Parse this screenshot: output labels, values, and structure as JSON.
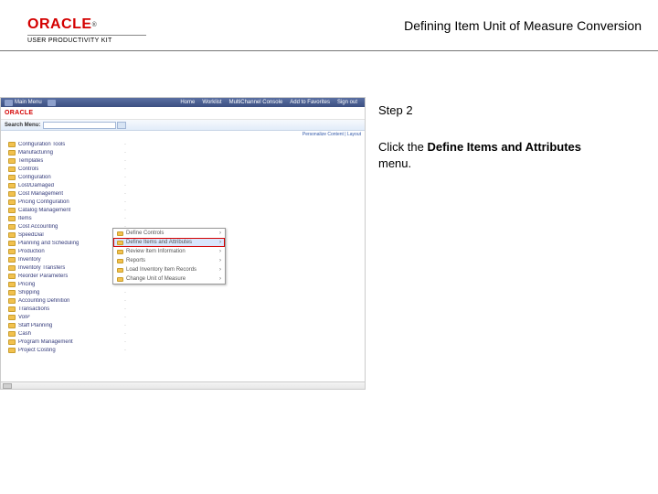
{
  "header": {
    "logo_text": "ORACLE",
    "logo_suffix": "®",
    "logo_sub": "USER PRODUCTIVITY KIT",
    "page_title": "Defining Item Unit of Measure Conversion"
  },
  "instruction": {
    "step_label": "Step 2",
    "text_pre": "Click the ",
    "text_bold": "Define Items and Attributes",
    "text_post": " menu."
  },
  "shot": {
    "topbar": {
      "nav_label": "Main Menu",
      "links": [
        "Home",
        "Worklist",
        "MultiChannel Console",
        "Add to Favorites",
        "Sign out"
      ]
    },
    "brand": "ORACLE",
    "search_label": "Search Menu:",
    "address_hint": "Personalize Content | Layout",
    "nav_items": [
      "Configuration Tools",
      "Manufacturing",
      "Templates",
      "Controls",
      "Configuration",
      "Lost/Damaged",
      "Cost Management",
      "Pricing Configuration",
      "Catalog Management",
      "Items",
      "Cost Accounting",
      "SpeedDial",
      "Planning and Scheduling",
      "Production",
      "Inventory",
      "Inventory Transfers",
      "Reorder Parameters",
      "Pricing",
      "Shipping",
      "Accounting Definition",
      "Transactions",
      "VoIP",
      "Staff Planning",
      "Cash",
      "Program Management",
      "Project Costing"
    ],
    "submenu": {
      "items": [
        "Define Controls",
        "Define Items and Attributes",
        "Review Item Information",
        "Reports",
        "Load Inventory Item Records",
        "Change Unit of Measure"
      ],
      "highlight_index": 1
    }
  }
}
